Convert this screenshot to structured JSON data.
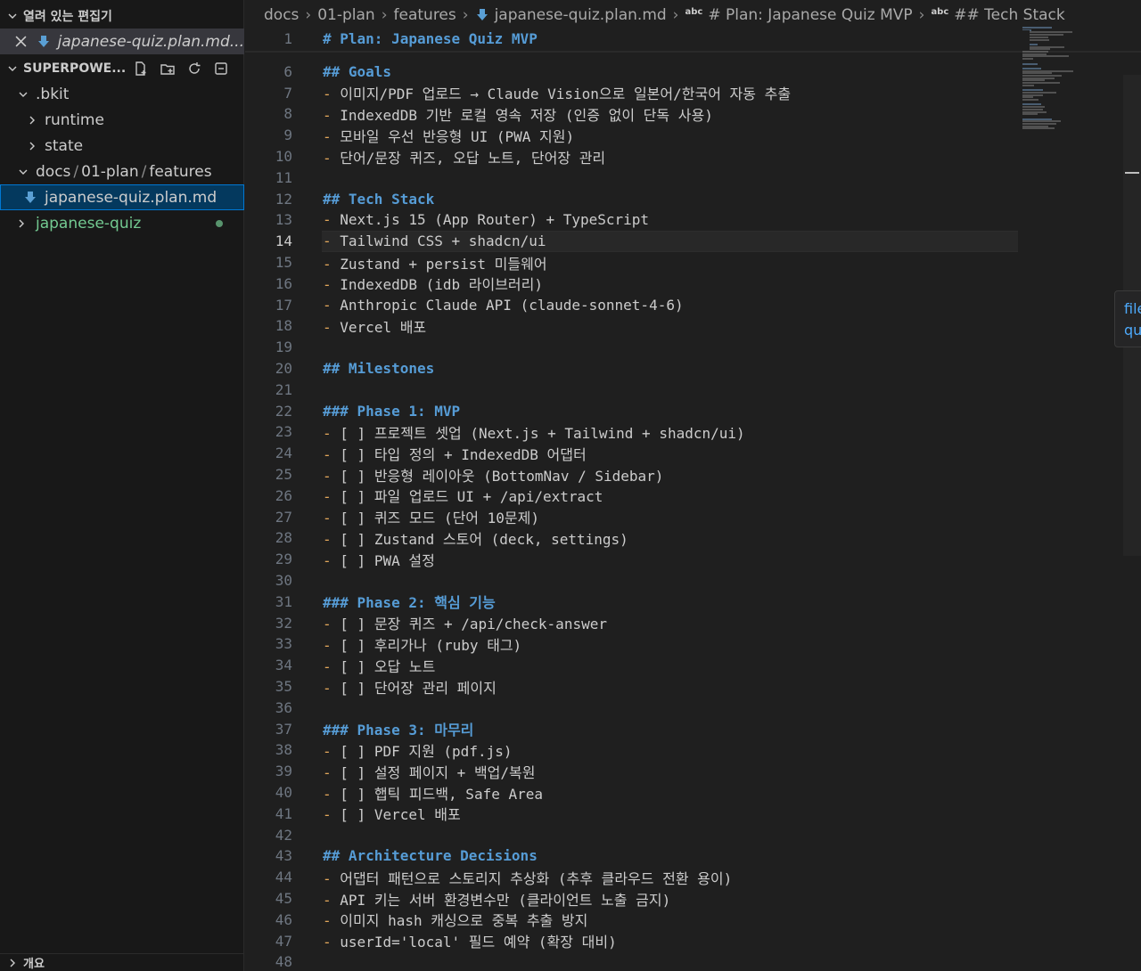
{
  "sidebar": {
    "open_editors_title": "열려 있는 편집기",
    "open_editor_file": "japanese-quiz.plan.md...",
    "workspace_title": "SUPERPOWE...",
    "tree": {
      "bkit": ".bkit",
      "runtime": "runtime",
      "state": "state",
      "docs_path": [
        "docs",
        "01-plan",
        "features"
      ],
      "active_file": "japanese-quiz.plan.md",
      "japanese_quiz": "japanese-quiz"
    },
    "outline_title": "개요"
  },
  "breadcrumb": {
    "items": [
      "docs",
      "01-plan",
      "features",
      "japanese-quiz.plan.md"
    ],
    "symbol1_icon": "abc",
    "symbol1": "# Plan: Japanese Quiz MVP",
    "symbol2_icon": "abc",
    "symbol2": "## Tech Stack"
  },
  "editor": {
    "sticky": {
      "num": "1",
      "text": "# Plan: Japanese Quiz MVP"
    },
    "active_line": "14",
    "lines": [
      {
        "num": "6",
        "kind": "heading",
        "text": "## Goals"
      },
      {
        "num": "7",
        "kind": "bullet",
        "text": "이미지/PDF 업로드 → Claude Vision으로 일본어/한국어 자동 추출"
      },
      {
        "num": "8",
        "kind": "bullet",
        "text": "IndexedDB 기반 로컬 영속 저장 (인증 없이 단독 사용)"
      },
      {
        "num": "9",
        "kind": "bullet",
        "text": "모바일 우선 반응형 UI (PWA 지원)"
      },
      {
        "num": "10",
        "kind": "bullet",
        "text": "단어/문장 퀴즈, 오답 노트, 단어장 관리"
      },
      {
        "num": "11",
        "kind": "blank",
        "text": ""
      },
      {
        "num": "12",
        "kind": "heading",
        "text": "## Tech Stack"
      },
      {
        "num": "13",
        "kind": "bullet",
        "text": "Next.js 15 (App Router) + TypeScript"
      },
      {
        "num": "14",
        "kind": "bullet",
        "text": "Tailwind CSS + shadcn/ui"
      },
      {
        "num": "15",
        "kind": "bullet",
        "text": "Zustand + persist 미들웨어"
      },
      {
        "num": "16",
        "kind": "bullet",
        "text": "IndexedDB (idb 라이브러리)"
      },
      {
        "num": "17",
        "kind": "bullet",
        "text": "Anthropic Claude API (claude-sonnet-4-6)"
      },
      {
        "num": "18",
        "kind": "bullet",
        "text": "Vercel 배포"
      },
      {
        "num": "19",
        "kind": "blank",
        "text": ""
      },
      {
        "num": "20",
        "kind": "heading",
        "text": "## Milestones"
      },
      {
        "num": "21",
        "kind": "blank",
        "text": ""
      },
      {
        "num": "22",
        "kind": "heading",
        "text": "### Phase 1: MVP"
      },
      {
        "num": "23",
        "kind": "bullet",
        "text": "[ ] 프로젝트 셋업 (Next.js + Tailwind + shadcn/ui)"
      },
      {
        "num": "24",
        "kind": "bullet",
        "text": "[ ] 타입 정의 + IndexedDB 어댑터"
      },
      {
        "num": "25",
        "kind": "bullet",
        "text": "[ ] 반응형 레이아웃 (BottomNav / Sidebar)"
      },
      {
        "num": "26",
        "kind": "bullet",
        "text": "[ ] 파일 업로드 UI + /api/extract"
      },
      {
        "num": "27",
        "kind": "bullet",
        "text": "[ ] 퀴즈 모드 (단어 10문제)"
      },
      {
        "num": "28",
        "kind": "bullet",
        "text": "[ ] Zustand 스토어 (deck, settings)"
      },
      {
        "num": "29",
        "kind": "bullet",
        "text": "[ ] PWA 설정"
      },
      {
        "num": "30",
        "kind": "blank",
        "text": ""
      },
      {
        "num": "31",
        "kind": "heading",
        "text": "### Phase 2: 핵심 기능"
      },
      {
        "num": "32",
        "kind": "bullet",
        "text": "[ ] 문장 퀴즈 + /api/check-answer"
      },
      {
        "num": "33",
        "kind": "bullet",
        "text": "[ ] 후리가나 (ruby 태그)"
      },
      {
        "num": "34",
        "kind": "bullet",
        "text": "[ ] 오답 노트"
      },
      {
        "num": "35",
        "kind": "bullet",
        "text": "[ ] 단어장 관리 페이지"
      },
      {
        "num": "36",
        "kind": "blank",
        "text": ""
      },
      {
        "num": "37",
        "kind": "heading",
        "text": "### Phase 3: 마무리"
      },
      {
        "num": "38",
        "kind": "bullet",
        "text": "[ ] PDF 지원 (pdf.js)"
      },
      {
        "num": "39",
        "kind": "bullet",
        "text": "[ ] 설정 페이지 + 백업/복원"
      },
      {
        "num": "40",
        "kind": "bullet",
        "text": "[ ] 햅틱 피드백, Safe Area"
      },
      {
        "num": "41",
        "kind": "bullet",
        "text": "[ ] Vercel 배포"
      },
      {
        "num": "42",
        "kind": "blank",
        "text": ""
      },
      {
        "num": "43",
        "kind": "heading",
        "text": "## Architecture Decisions"
      },
      {
        "num": "44",
        "kind": "bullet",
        "text": "어댑터 패턴으로 스토리지 추상화 (추후 클라우드 전환 용이)"
      },
      {
        "num": "45",
        "kind": "bullet",
        "text": "API 키는 서버 환경변수만 (클라이언트 노출 금지)"
      },
      {
        "num": "46",
        "kind": "bullet",
        "text": "이미지 hash 캐싱으로 중복 추출 방지"
      },
      {
        "num": "47",
        "kind": "bullet",
        "text": "userId='local' 필드 예약 (확장 대비)"
      },
      {
        "num": "48",
        "kind": "blank",
        "text": ""
      }
    ],
    "bullet_char": "-"
  },
  "hover_panel": {
    "line1": "file",
    "line2": "qu"
  },
  "colors": {
    "heading": "#569cd6",
    "dash": "#e2a75b",
    "accent": "#0078d4",
    "git_added": "#73c991"
  }
}
